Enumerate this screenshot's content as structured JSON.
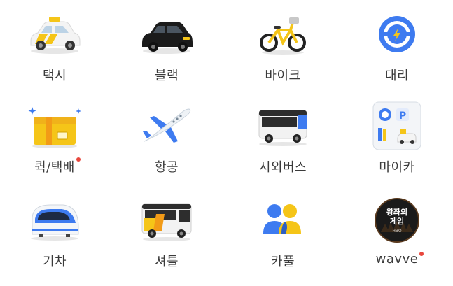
{
  "colors": {
    "label": "#3a3a3a",
    "new_dot": "#e8473d",
    "taxi_yellow": "#f5c518",
    "kakao_blue": "#3e7bf0"
  },
  "services": [
    {
      "label": "택시",
      "icon": "taxi-icon",
      "new": false
    },
    {
      "label": "블랙",
      "icon": "black-car-icon",
      "new": false
    },
    {
      "label": "바이크",
      "icon": "bike-icon",
      "new": false
    },
    {
      "label": "대리",
      "icon": "steering-wheel-icon",
      "new": false
    },
    {
      "label": "퀵/택배",
      "icon": "parcel-box-icon",
      "new": true
    },
    {
      "label": "항공",
      "icon": "airplane-icon",
      "new": false
    },
    {
      "label": "시외버스",
      "icon": "bus-icon",
      "new": false
    },
    {
      "label": "마이카",
      "icon": "mycar-icon",
      "new": false
    },
    {
      "label": "기차",
      "icon": "train-icon",
      "new": false
    },
    {
      "label": "셔틀",
      "icon": "shuttle-icon",
      "new": false
    },
    {
      "label": "카풀",
      "icon": "carpool-icon",
      "new": false
    },
    {
      "label": "wavve",
      "icon": "wavve-icon",
      "new": true
    }
  ],
  "wavve_logo_text": "왕좌의 게임"
}
